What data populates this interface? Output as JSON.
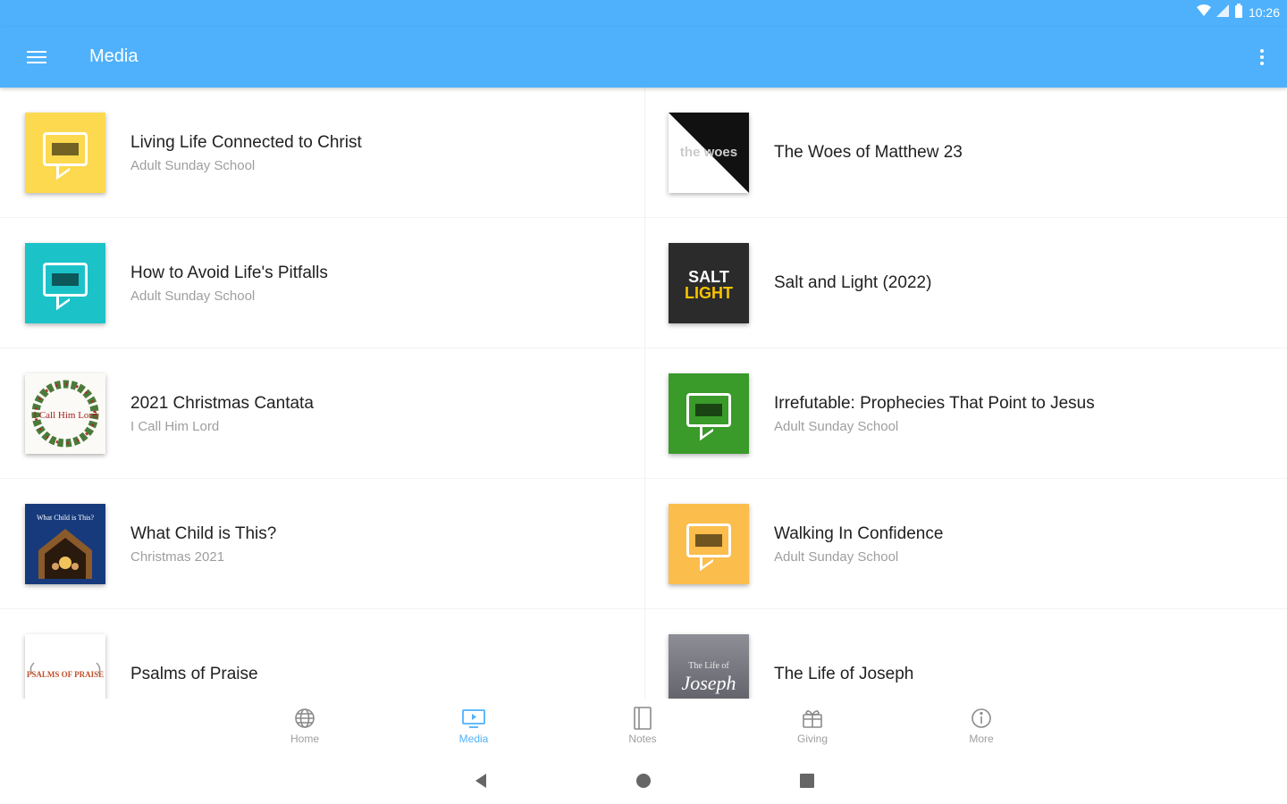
{
  "status_bar": {
    "time": "10:26"
  },
  "app_bar": {
    "title": "Media"
  },
  "left_column": [
    {
      "title": "Living Life Connected to Christ",
      "subtitle": "Adult Sunday School",
      "thumb": "yellow-chat-bubble"
    },
    {
      "title": "How to Avoid Life's Pitfalls",
      "subtitle": "Adult Sunday School",
      "thumb": "teal-chat-bubble"
    },
    {
      "title": "2021 Christmas Cantata",
      "subtitle": "I Call Him Lord",
      "thumb": "wreath",
      "thumb_text": "I Call Him Lord"
    },
    {
      "title": "What Child is This?",
      "subtitle": "Christmas 2021",
      "thumb": "nativity",
      "thumb_text": "What Child is This?"
    },
    {
      "title": "Psalms of Praise",
      "subtitle": "",
      "thumb": "praise",
      "thumb_text": "PSALMS OF PRAISE"
    }
  ],
  "right_column": [
    {
      "title": "The Woes of Matthew 23",
      "subtitle": "",
      "thumb": "woes",
      "thumb_text": "the woes"
    },
    {
      "title": "Salt and Light (2022)",
      "subtitle": "",
      "thumb": "salt-light",
      "thumb_text_1": "SALT",
      "thumb_text_2": "LIGHT"
    },
    {
      "title": "Irrefutable: Prophecies That Point to Jesus",
      "subtitle": "Adult Sunday School",
      "thumb": "green-chat-bubble"
    },
    {
      "title": "Walking In Confidence",
      "subtitle": "Adult Sunday School",
      "thumb": "orange-chat-bubble"
    },
    {
      "title": "The Life of Joseph",
      "subtitle": "",
      "thumb": "joseph",
      "thumb_text_1": "The Life of",
      "thumb_text_2": "Joseph"
    }
  ],
  "bottom_nav": [
    {
      "label": "Home",
      "icon": "globe-icon",
      "active": false
    },
    {
      "label": "Media",
      "icon": "monitor-play-icon",
      "active": true
    },
    {
      "label": "Notes",
      "icon": "notebook-icon",
      "active": false
    },
    {
      "label": "Giving",
      "icon": "gift-icon",
      "active": false
    },
    {
      "label": "More",
      "icon": "info-icon",
      "active": false
    }
  ],
  "colors": {
    "primary": "#4fb1fc",
    "yellow": "#fdd94f",
    "teal": "#1bc3c9",
    "green": "#3a9a2a",
    "orange": "#fbbd4b"
  }
}
